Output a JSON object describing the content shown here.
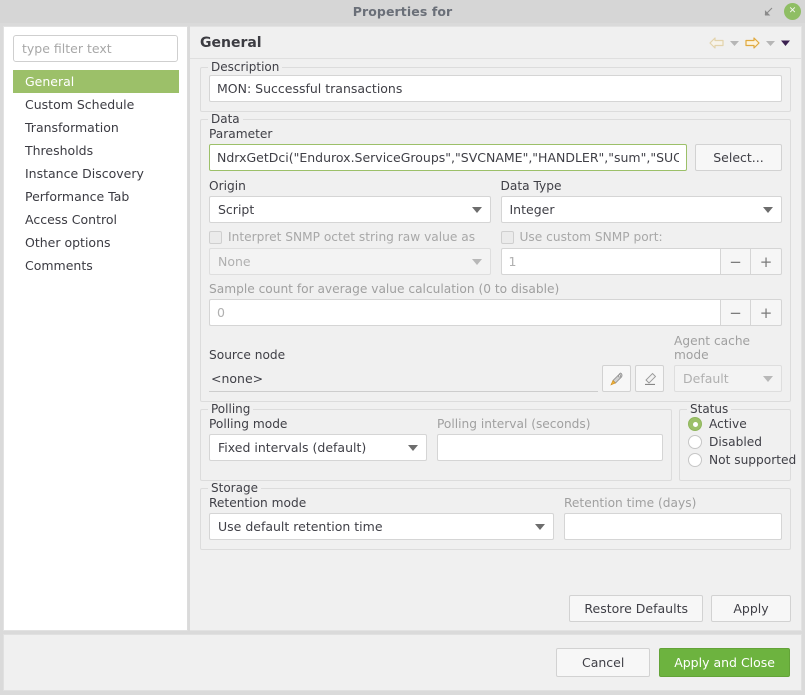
{
  "window": {
    "title": "Properties for",
    "restore_icon": "restore-window-icon",
    "close_icon": "close-icon"
  },
  "sidebar": {
    "filter": {
      "placeholder": "type filter text",
      "value": ""
    },
    "items": [
      {
        "label": "General",
        "selected": true
      },
      {
        "label": "Custom Schedule",
        "selected": false
      },
      {
        "label": "Transformation",
        "selected": false
      },
      {
        "label": "Thresholds",
        "selected": false
      },
      {
        "label": "Instance Discovery",
        "selected": false
      },
      {
        "label": "Performance Tab",
        "selected": false
      },
      {
        "label": "Access Control",
        "selected": false
      },
      {
        "label": "Other options",
        "selected": false
      },
      {
        "label": "Comments",
        "selected": false
      }
    ]
  },
  "header": {
    "title": "General",
    "back_icon": "back-arrow-icon",
    "back_menu_icon": "chevron-down-icon",
    "forward_icon": "forward-arrow-icon",
    "forward_menu_icon": "chevron-down-icon",
    "menu_icon": "chevron-down-icon"
  },
  "description": {
    "group_title": "Description",
    "value": "MON: Successful transactions"
  },
  "data_group": {
    "group_title": "Data",
    "parameter": {
      "label": "Parameter",
      "value": "NdrxGetDci(\"Endurox.ServiceGroups\",\"SVCNAME\",\"HANDLER\",\"sum\",\"SUCCESSFUL\")",
      "select_button": "Select..."
    },
    "origin": {
      "label": "Origin",
      "value": "Script"
    },
    "data_type": {
      "label": "Data Type",
      "value": "Integer"
    },
    "snmp_octet": {
      "label": "Interpret SNMP octet string raw value as",
      "checked": false,
      "combo_value": "None"
    },
    "snmp_port": {
      "label": "Use custom SNMP port:",
      "checked": false,
      "value": "1",
      "minus": "−",
      "plus": "+"
    },
    "sample_count": {
      "label": "Sample count for average value calculation (0 to disable)",
      "value": "0",
      "minus": "−",
      "plus": "+"
    },
    "source_node": {
      "label": "Source node",
      "value": "<none>",
      "select_icon": "rocket-select-node-icon",
      "clear_icon": "eraser-clear-icon"
    },
    "agent_cache_mode": {
      "label": "Agent cache mode",
      "value": "Default"
    }
  },
  "polling": {
    "group_title": "Polling",
    "mode": {
      "label": "Polling mode",
      "value": "Fixed intervals (default)"
    },
    "interval": {
      "label": "Polling interval (seconds)",
      "value": ""
    }
  },
  "status": {
    "group_title": "Status",
    "options": [
      {
        "label": "Active",
        "checked": true
      },
      {
        "label": "Disabled",
        "checked": false
      },
      {
        "label": "Not supported",
        "checked": false
      }
    ]
  },
  "storage": {
    "group_title": "Storage",
    "retention_mode": {
      "label": "Retention mode",
      "value": "Use default retention time"
    },
    "retention_time": {
      "label": "Retention time (days)",
      "value": ""
    }
  },
  "actions": {
    "restore_defaults": "Restore Defaults",
    "apply": "Apply",
    "cancel": "Cancel",
    "apply_and_close": "Apply and Close"
  },
  "colors": {
    "accent_green": "#9cc069",
    "primary_button": "#6db33f",
    "titlebar": "#d6d6d6",
    "panel_bg": "#f0f0f0"
  }
}
